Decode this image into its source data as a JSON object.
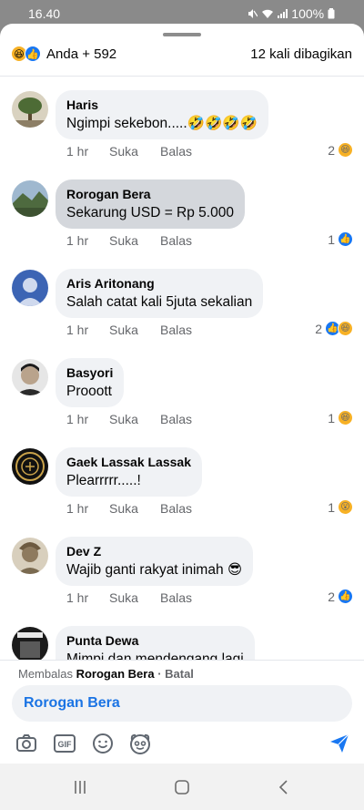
{
  "status": {
    "time": "16.40",
    "battery": "100%"
  },
  "sheet_header": {
    "reaction_summary": "Anda + 592",
    "share_count": "12 kali dibagikan"
  },
  "comments": [
    {
      "author": "Haris",
      "text": "Ngimpi sekebon.....🤣🤣🤣🤣",
      "time": "1 hr",
      "like": "Suka",
      "reply": "Balas",
      "react_count": "2",
      "reactions": [
        "haha"
      ],
      "avatar": "tree-avatar"
    },
    {
      "author": "Rorogan Bera",
      "text": "Sekarung USD = Rp 5.000",
      "time": "1 hr",
      "like": "Suka",
      "reply": "Balas",
      "react_count": "1",
      "reactions": [
        "like"
      ],
      "avatar": "landscape-avatar",
      "highlighted": true
    },
    {
      "author": "Aris Aritonang",
      "text": "Salah catat kali 5juta sekalian",
      "time": "1 hr",
      "like": "Suka",
      "reply": "Balas",
      "react_count": "2",
      "reactions": [
        "like",
        "haha"
      ],
      "avatar": "blue-avatar"
    },
    {
      "author": "Basyori",
      "text": "Prooott",
      "time": "1 hr",
      "like": "Suka",
      "reply": "Balas",
      "react_count": "1",
      "reactions": [
        "haha"
      ],
      "avatar": "face-avatar"
    },
    {
      "author": "Gaek Lassak Lassak",
      "text": "Plearrrrr.....!",
      "time": "1 hr",
      "like": "Suka",
      "reply": "Balas",
      "react_count": "1",
      "reactions": [
        "wow"
      ],
      "avatar": "emblem-avatar"
    },
    {
      "author": "Dev Z",
      "text": "Wajib ganti rakyat inimah 😎",
      "time": "1 hr",
      "like": "Suka",
      "reply": "Balas",
      "react_count": "2",
      "reactions": [
        "like"
      ],
      "avatar": "statue-avatar"
    },
    {
      "author": "Punta Dewa",
      "text": "Mimpi dan mendengang lagi",
      "time": "",
      "like": "",
      "reply": "",
      "react_count": "",
      "reactions": [],
      "avatar": "poster-avatar"
    }
  ],
  "reply_box": {
    "replying_prefix": "Membalas",
    "replying_to": "Rorogan Bera",
    "cancel": "· Batal",
    "input_value": "Rorogan Bera"
  },
  "toolbar_icons": [
    "camera-icon",
    "gif-icon",
    "emoji-icon",
    "sticker-icon",
    "send-icon"
  ],
  "colors": {
    "like_blue": "#1877f2",
    "haha_yellow": "#f7b125",
    "mention_blue": "#1b74e4",
    "bubble_grey": "#f0f2f5"
  }
}
